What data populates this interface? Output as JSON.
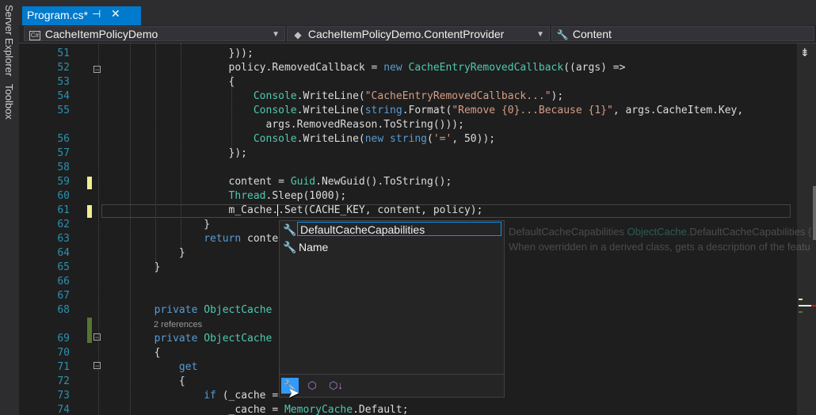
{
  "sidebar": {
    "items": [
      {
        "label": "Server Explorer"
      },
      {
        "label": "Toolbox"
      }
    ]
  },
  "tab": {
    "title": "Program.cs*",
    "pin": "⊣",
    "close": "✕"
  },
  "navbar": {
    "project": {
      "label": "CacheItemPolicyDemo",
      "icon": "cs-project-icon",
      "badge": "C#"
    },
    "type": {
      "label": "CacheItemPolicyDemo.ContentProvider",
      "icon": "class-icon"
    },
    "member": {
      "label": "Content",
      "icon": "wrench-icon"
    }
  },
  "code": {
    "lines": [
      {
        "num": "51",
        "text": "                    }));"
      },
      {
        "num": "52",
        "text": "                    policy.RemovedCallback = new CacheEntryRemovedCallback((args) =>"
      },
      {
        "num": "53",
        "text": "                    {"
      },
      {
        "num": "54",
        "text": "                        Console.WriteLine(\"CacheEntryRemovedCallback...\");"
      },
      {
        "num": "55",
        "text": "                        Console.WriteLine(string.Format(\"Remove {0}...Because {1}\", args.CacheItem.Key,"
      },
      {
        "num": "",
        "text": "                          args.RemovedReason.ToString()));"
      },
      {
        "num": "56",
        "text": "                        Console.WriteLine(new string('=', 50));"
      },
      {
        "num": "57",
        "text": "                    });"
      },
      {
        "num": "58",
        "text": ""
      },
      {
        "num": "59",
        "text": "                    content = Guid.NewGuid().ToString();"
      },
      {
        "num": "60",
        "text": "                    Thread.Sleep(1000);"
      },
      {
        "num": "61",
        "text": "                    m_Cache.|.Set(CACHE_KEY, content, policy);"
      },
      {
        "num": "62",
        "text": "                }"
      },
      {
        "num": "63",
        "text": "                return conte"
      },
      {
        "num": "64",
        "text": "            }"
      },
      {
        "num": "65",
        "text": "        }"
      },
      {
        "num": "66",
        "text": ""
      },
      {
        "num": "67",
        "text": ""
      },
      {
        "num": "68",
        "text": "        private ObjectCache"
      },
      {
        "num": "",
        "text": "2 references",
        "lens": true
      },
      {
        "num": "69",
        "text": "        private ObjectCache"
      },
      {
        "num": "70",
        "text": "        {"
      },
      {
        "num": "71",
        "text": "            get"
      },
      {
        "num": "72",
        "text": "            {"
      },
      {
        "num": "73",
        "text": "                if (_cache ="
      },
      {
        "num": "74",
        "text": "                    _cache = MemoryCache.Default;"
      }
    ]
  },
  "intellisense": {
    "items": [
      {
        "label": "DefaultCacheCapabilities",
        "icon": "wrench-icon",
        "selected": true
      },
      {
        "label": "Name",
        "icon": "wrench-icon",
        "selected": false
      }
    ],
    "filters": [
      {
        "icon": "property-filter-icon",
        "glyph": "🔧",
        "active": true
      },
      {
        "icon": "method-filter-icon",
        "glyph": "⬡",
        "active": false
      },
      {
        "icon": "extension-method-filter-icon",
        "glyph": "⬡↓",
        "active": false
      }
    ]
  },
  "tooltip": {
    "line1_name": "DefaultCacheCapabilities",
    "line1_class": "ObjectCache",
    "line1_member": ".DefaultCacheCapabilities {",
    "line2": "When overridden in a derived class, gets a description of the featu"
  },
  "colors": {
    "keyword": "#569cd6",
    "type": "#4ec9b0",
    "string": "#d69d85",
    "text": "#dcdcdc",
    "linenum": "#2b91af",
    "accent": "#007acc"
  }
}
